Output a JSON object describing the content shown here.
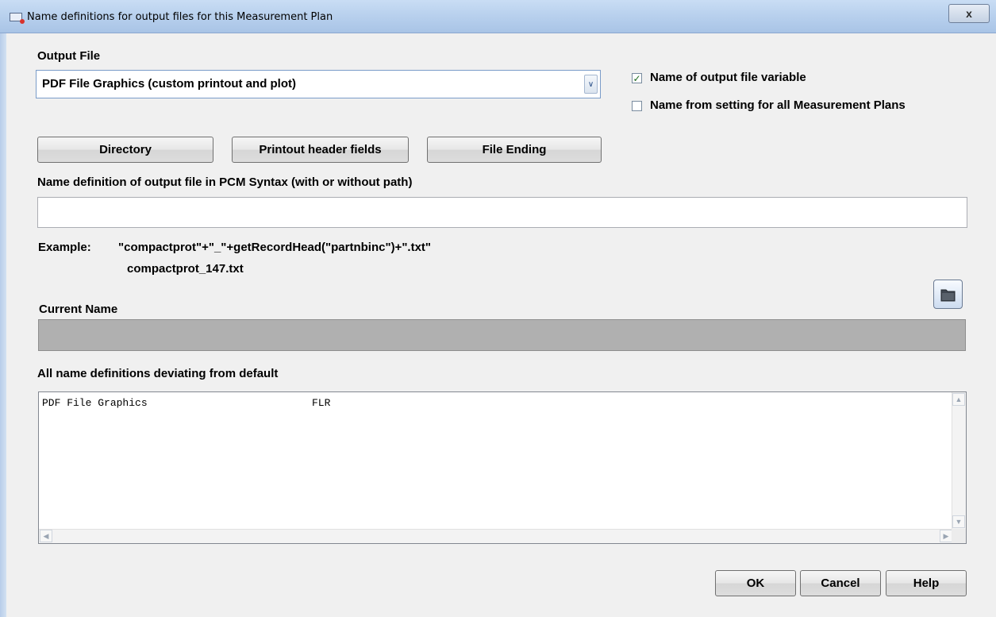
{
  "window": {
    "title": "Name definitions for output files for this Measurement Plan",
    "close_glyph": "x"
  },
  "output_file": {
    "label": "Output File",
    "selected": "PDF File Graphics (custom printout and plot)",
    "arrow_glyph": "∨"
  },
  "options": {
    "variable_label": "Name of output file variable",
    "variable_checked": true,
    "all_plans_label": "Name from setting for all Measurement Plans",
    "all_plans_checked": false
  },
  "buttons": {
    "directory": "Directory",
    "printout_header": "Printout header fields",
    "file_ending": "File Ending",
    "ok": "OK",
    "cancel": "Cancel",
    "help": "Help"
  },
  "name_definition": {
    "label": "Name definition of output file in PCM Syntax (with or without path)",
    "value": ""
  },
  "example": {
    "label": "Example:",
    "syntax": "\"compactprot\"+\"_\"+getRecordHead(\"partnbinc\")+\".txt\"",
    "result": "compactprot_147.txt"
  },
  "current_name": {
    "label": "Current Name",
    "value": ""
  },
  "deviating": {
    "label": "All name definitions deviating from default",
    "rows": [
      {
        "name": "PDF File Graphics",
        "value": "FLR"
      }
    ]
  },
  "icons": {
    "folder": "folder-icon",
    "checkmark": "✓"
  }
}
